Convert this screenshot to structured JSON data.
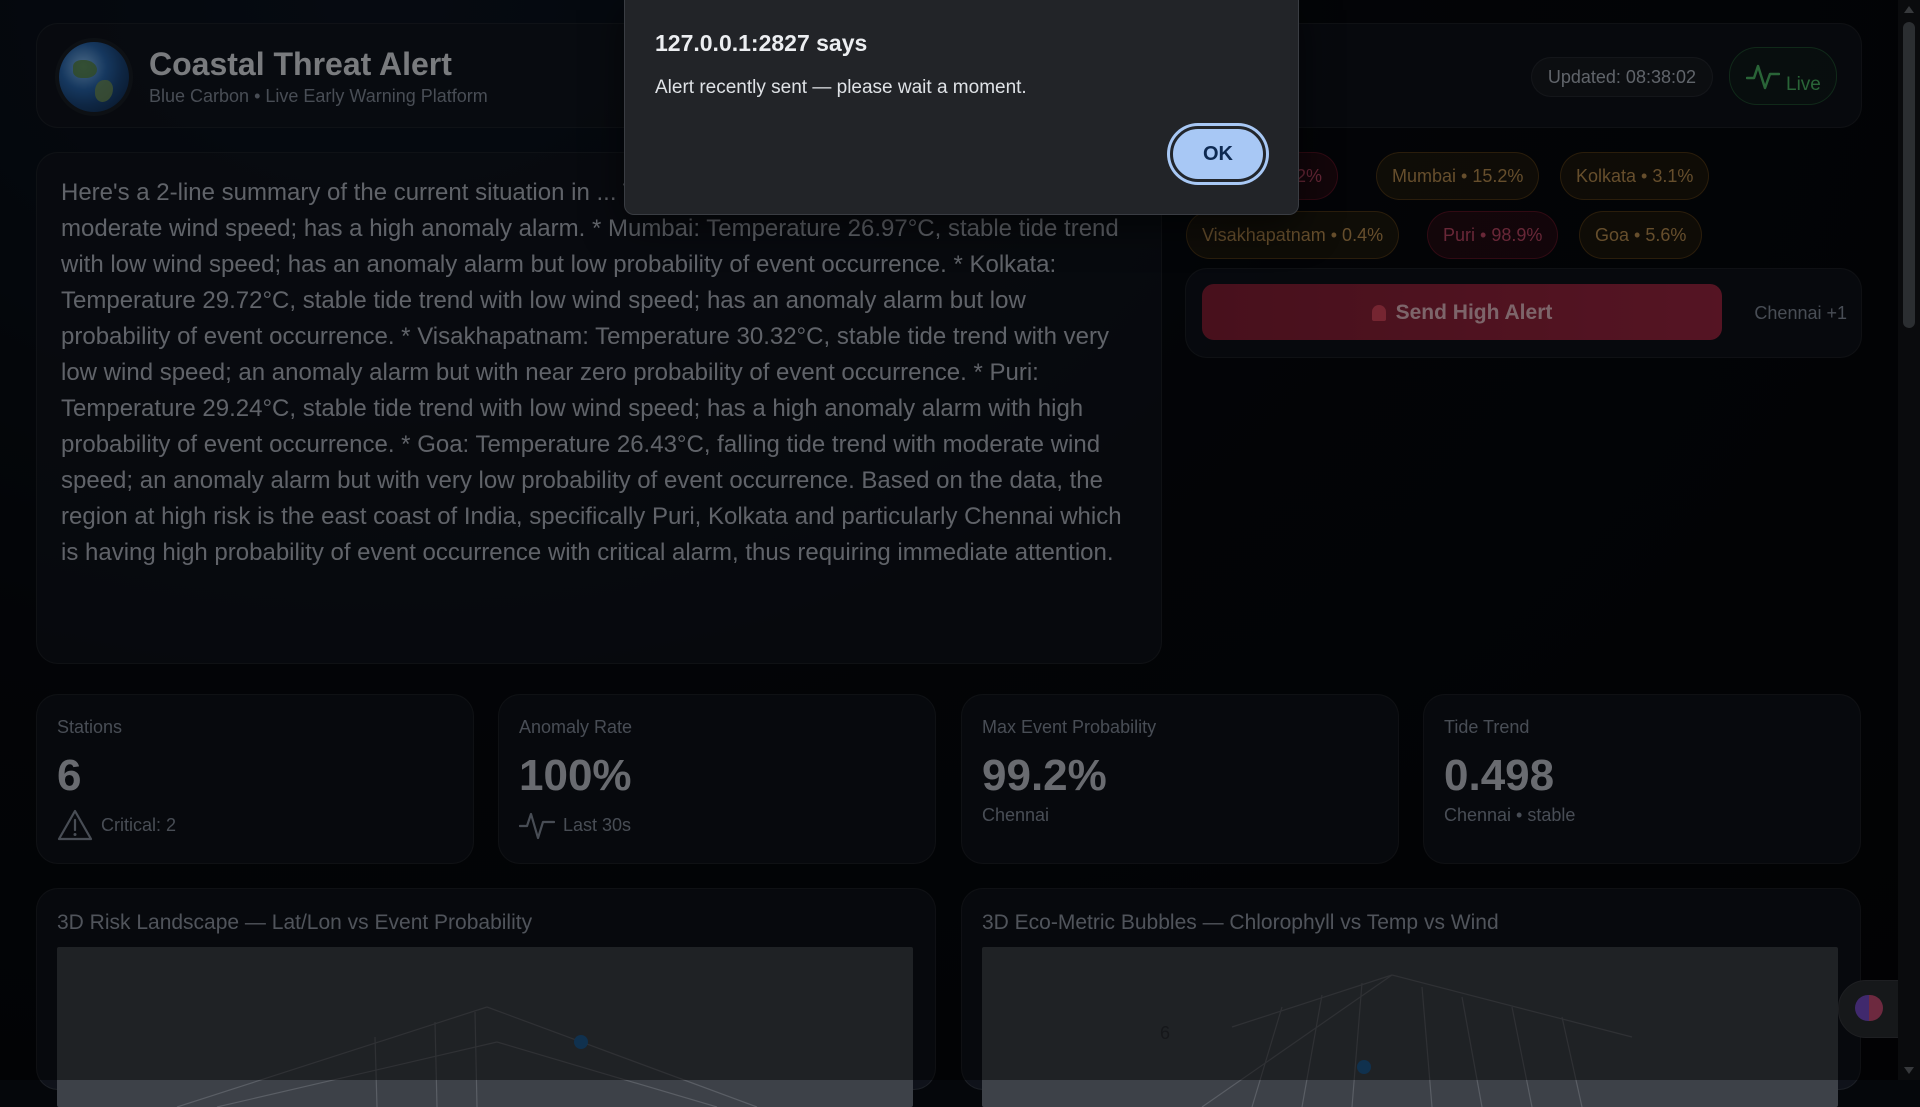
{
  "header": {
    "title": "Coastal Threat Alert",
    "subtitle": "Blue Carbon • Live Early Warning Platform",
    "updated": "Updated: 08:38:02",
    "live_label": "Live"
  },
  "summary": {
    "text": "Here's a 2-line summary of the current situation in ... Temperature 29.08°C, stable tide trend with moderate wind speed; has a high anomaly alarm. * Mumbai: Temperature 26.97°C, stable tide trend with low wind speed; has an anomaly alarm but low probability of event occurrence. * Kolkata: Temperature 29.72°C, stable tide trend with low wind speed; has an anomaly alarm but low probability of event occurrence. * Visakhapatnam: Temperature 30.32°C, stable tide trend with very low wind speed; an anomaly alarm but with near zero probability of event occurrence. * Puri: Temperature 29.24°C, stable tide trend with low wind speed; has a high anomaly alarm with high probability of event occurrence. * Goa: Temperature 26.43°C, falling tide trend with moderate wind speed; an anomaly alarm but with very low probability of event occurrence. Based on the data, the region at high risk is the east coast of India, specifically Puri, Kolkata and particularly Chennai which is having high probability of event occurrence with critical alarm, thus requiring immediate attention."
  },
  "stations_chips": [
    {
      "label": "99.2%"
    },
    {
      "label": "Mumbai • 15.2%"
    },
    {
      "label": "Kolkata • 3.1%"
    },
    {
      "label": "Visakhapatnam • 0.4%"
    },
    {
      "label": "Puri • 98.9%"
    },
    {
      "label": "Goa • 5.6%"
    }
  ],
  "alert": {
    "button_label": "Send High Alert",
    "target": "Chennai +1"
  },
  "stats": [
    {
      "label": "Stations",
      "value": "6",
      "sub": "Critical: 2"
    },
    {
      "label": "Anomaly Rate",
      "value": "100%",
      "sub": "Last 30s"
    },
    {
      "label": "Max Event Probability",
      "value": "99.2%",
      "sub": "Chennai"
    },
    {
      "label": "Tide Trend",
      "value": "0.498",
      "sub": "Chennai • stable"
    }
  ],
  "charts": [
    {
      "title": "3D Risk Landscape — Lat/Lon vs Event Probability"
    },
    {
      "title": "3D Eco-Metric Bubbles — Chlorophyll vs Temp vs Wind",
      "axis_tick": "6"
    }
  ],
  "dialog": {
    "title": "127.0.0.1:2827 says",
    "message": "Alert recently sent — please wait a moment.",
    "ok_label": "OK"
  },
  "colors": {
    "critical": "#c74b6a",
    "warning": "#c49655",
    "live": "#4fc06a",
    "ok_button": "#a8c8f5"
  }
}
